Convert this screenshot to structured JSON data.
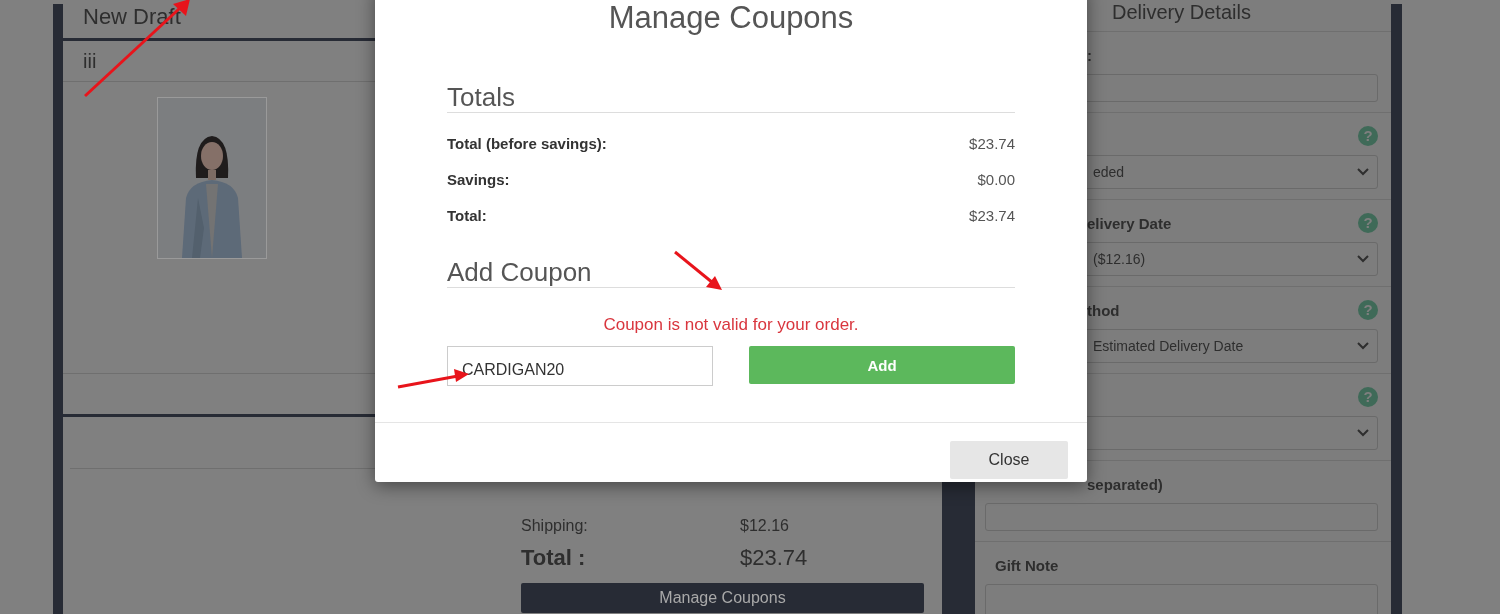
{
  "left_panel": {
    "title": "New Draft",
    "item_name": "iii"
  },
  "order_summary": {
    "rows": [
      {
        "label": "Shipping:",
        "value": "$12.16"
      }
    ],
    "total": {
      "label": "Total :",
      "value": "$23.74"
    },
    "manage_button": "Manage Coupons"
  },
  "delivery_details": {
    "title": "Delivery Details",
    "fields": [
      {
        "kind": "input",
        "label": ":"
      },
      {
        "kind": "select",
        "help": "?",
        "value": "eded"
      },
      {
        "kind": "select",
        "label": "elivery Date",
        "help": "?",
        "value": "($12.16)"
      },
      {
        "kind": "select",
        "label": "thod",
        "help": "?",
        "value": "Estimated Delivery Date"
      },
      {
        "kind": "select",
        "help": "?"
      },
      {
        "kind": "input",
        "label": "separated)"
      },
      {
        "kind": "textarea",
        "label": "Gift Note"
      }
    ]
  },
  "modal": {
    "title": "Manage Coupons",
    "totals_heading": "Totals",
    "totals": [
      {
        "label": "Total (before savings):",
        "value": "$23.74"
      },
      {
        "label": "Savings:",
        "value": "$0.00"
      },
      {
        "label": "Total:",
        "value": "$23.74"
      }
    ],
    "coupon_heading": "Add Coupon",
    "error": "Coupon is not valid for your order.",
    "coupon_input": {
      "value": "CARDIGAN20"
    },
    "add_button": "Add",
    "close_button": "Close"
  }
}
